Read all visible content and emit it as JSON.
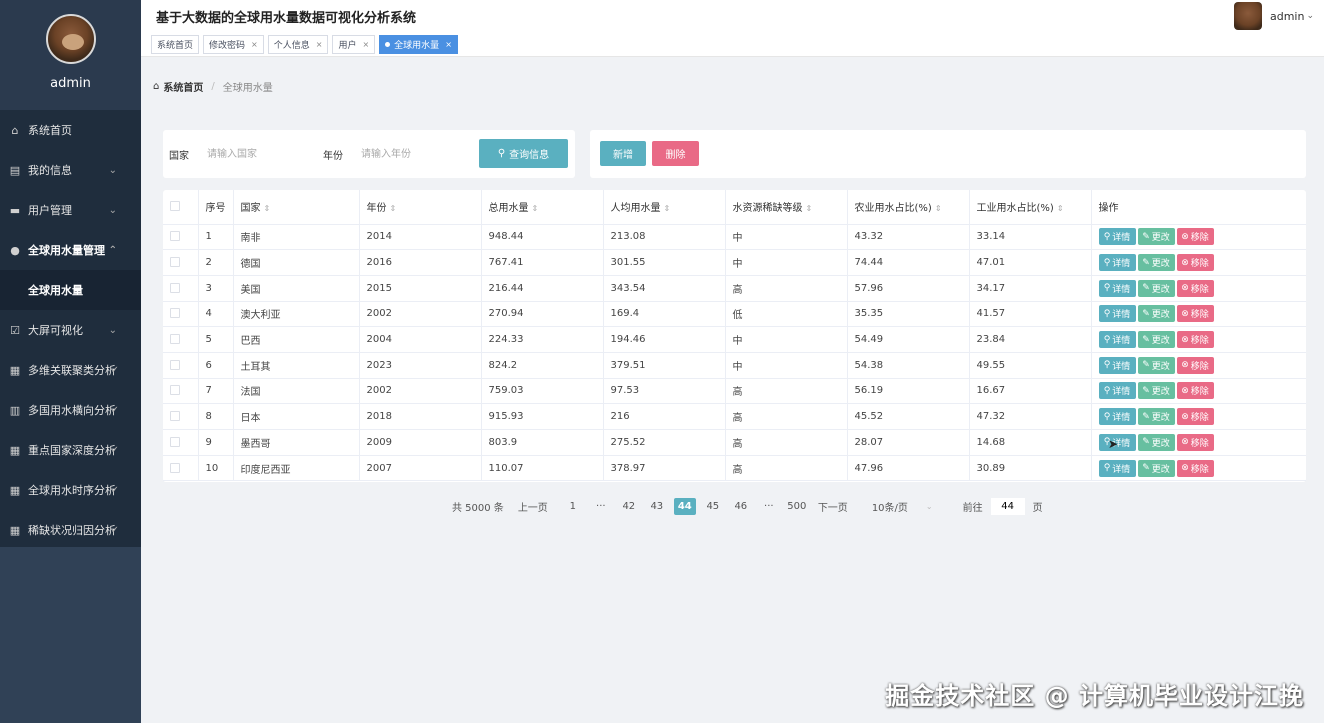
{
  "sidebar": {
    "username": "admin",
    "menu": [
      {
        "label": "系统首页",
        "icon": "home-icon",
        "glyph": "⌂",
        "arrow": ""
      },
      {
        "label": "我的信息",
        "icon": "profile-icon",
        "glyph": "▤",
        "arrow": "⌄"
      },
      {
        "label": "用户管理",
        "icon": "user-manage-icon",
        "glyph": "▬",
        "arrow": "⌄"
      },
      {
        "label": "全球用水量管理",
        "icon": "person-icon",
        "glyph": "●",
        "arrow": "⌃"
      },
      {
        "label": "大屏可视化",
        "icon": "checklist-icon",
        "glyph": "☑",
        "arrow": "⌄"
      },
      {
        "label": "多维关联聚类分析",
        "icon": "grid-icon",
        "glyph": "▦",
        "arrow": "✓"
      },
      {
        "label": "多国用水横向分析",
        "icon": "bar-chart-icon",
        "glyph": "▥",
        "arrow": "✓"
      },
      {
        "label": "重点国家深度分析",
        "icon": "grid-icon",
        "glyph": "▦",
        "arrow": "✓"
      },
      {
        "label": "全球用水时序分析",
        "icon": "grid-icon",
        "glyph": "▦",
        "arrow": "✓"
      },
      {
        "label": "稀缺状况归因分析",
        "icon": "grid-icon",
        "glyph": "▦",
        "arrow": "✓"
      }
    ],
    "submenu_active": "全球用水量"
  },
  "header": {
    "title": "基于大数据的全球用水量数据可视化分析系统",
    "user": "admin",
    "tabs": [
      {
        "label": "系统首页",
        "closable": false,
        "active": false
      },
      {
        "label": "修改密码",
        "closable": true,
        "active": false
      },
      {
        "label": "个人信息",
        "closable": true,
        "active": false
      },
      {
        "label": "用户",
        "closable": true,
        "active": false
      },
      {
        "label": "全球用水量",
        "closable": true,
        "active": true
      }
    ],
    "close_glyph": "×"
  },
  "breadcrumb": {
    "home": "系统首页",
    "home_icon": "⌂",
    "separator": "/",
    "current": "全球用水量"
  },
  "search": {
    "country_label": "国家",
    "country_placeholder": "请输入国家",
    "year_label": "年份",
    "year_placeholder": "请输入年份",
    "button": "查询信息",
    "button_icon": "⚲"
  },
  "actions": {
    "add": "新增",
    "delete": "删除"
  },
  "table": {
    "columns": [
      "序号",
      "国家",
      "年份",
      "总用水量",
      "人均用水量",
      "水资源稀缺等级",
      "农业用水占比(%)",
      "工业用水占比(%)",
      "操作"
    ],
    "sortable": [
      false,
      true,
      true,
      true,
      true,
      true,
      true,
      true,
      false
    ],
    "sort_glyph": "⇕",
    "op_labels": {
      "detail": "详情",
      "edit": "更改",
      "remove": "移除"
    },
    "op_icons": {
      "detail": "⚲",
      "edit": "✎",
      "remove": "⊗"
    },
    "rows": [
      [
        "1",
        "南非",
        "2014",
        "948.44",
        "213.08",
        "中",
        "43.32",
        "33.14"
      ],
      [
        "2",
        "德国",
        "2016",
        "767.41",
        "301.55",
        "中",
        "74.44",
        "47.01"
      ],
      [
        "3",
        "美国",
        "2015",
        "216.44",
        "343.54",
        "高",
        "57.96",
        "34.17"
      ],
      [
        "4",
        "澳大利亚",
        "2002",
        "270.94",
        "169.4",
        "低",
        "35.35",
        "41.57"
      ],
      [
        "5",
        "巴西",
        "2004",
        "224.33",
        "194.46",
        "中",
        "54.49",
        "23.84"
      ],
      [
        "6",
        "土耳其",
        "2023",
        "824.2",
        "379.51",
        "中",
        "54.38",
        "49.55"
      ],
      [
        "7",
        "法国",
        "2002",
        "759.03",
        "97.53",
        "高",
        "56.19",
        "16.67"
      ],
      [
        "8",
        "日本",
        "2018",
        "915.93",
        "216",
        "高",
        "45.52",
        "47.32"
      ],
      [
        "9",
        "墨西哥",
        "2009",
        "803.9",
        "275.52",
        "高",
        "28.07",
        "14.68"
      ],
      [
        "10",
        "印度尼西亚",
        "2007",
        "110.07",
        "378.97",
        "高",
        "47.96",
        "30.89"
      ]
    ]
  },
  "pagination": {
    "total": "共 5000 条",
    "prev": "上一页",
    "pages": [
      "1",
      "···",
      "42",
      "43",
      "44",
      "45",
      "46",
      "···",
      "500"
    ],
    "current": "44",
    "next": "下一页",
    "page_size": "10条/页",
    "goto_label": "前往",
    "goto_value": "44",
    "goto_suffix": "页"
  },
  "watermark": "掘金技术社区 @ 计算机毕业设计江挽",
  "colors": {
    "sidebar": "#304156",
    "menu": "#1f2d3d",
    "accent": "#5ab0c0",
    "danger": "#e96a86",
    "success": "#67bfa0",
    "tab_active": "#4a90e2"
  }
}
